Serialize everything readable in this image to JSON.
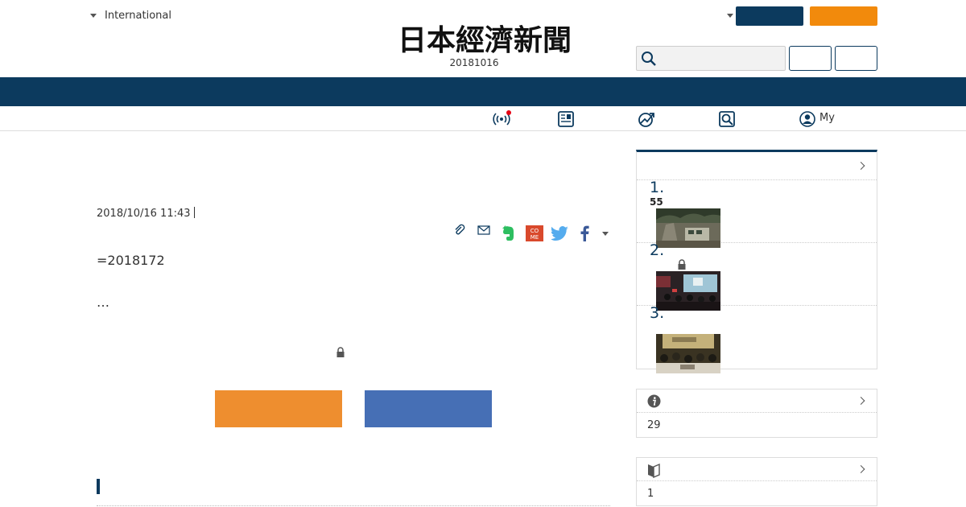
{
  "header": {
    "region_label": "International",
    "logo_text": "日本經濟新聞",
    "edition_date": "20181016"
  },
  "subnav": {
    "my_label": "My"
  },
  "article": {
    "timestamp": "2018/10/16 11:43",
    "lead_text": "=2018172",
    "ellipsis": "…"
  },
  "sidebar": {
    "ranking": {
      "items": [
        {
          "rank": "1.",
          "sub": "55"
        },
        {
          "rank": "2.",
          "sub": ""
        },
        {
          "rank": "3.",
          "sub": ""
        }
      ]
    },
    "info_panel": {
      "value": "29"
    },
    "beginner_panel": {
      "value": "1"
    }
  },
  "colors": {
    "navy": "#0c3a5e",
    "orange": "#f28a0c",
    "cta_orange": "#ee8e2f",
    "cta_blue": "#466fb5",
    "live_dot": "#e60012"
  }
}
